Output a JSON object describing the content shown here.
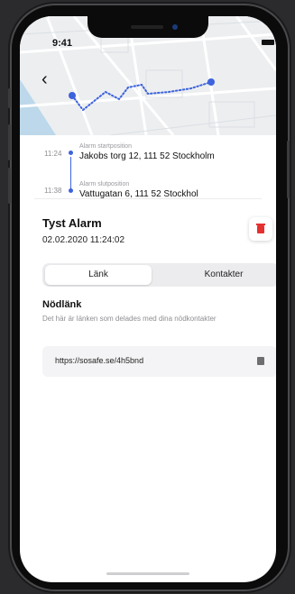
{
  "status": {
    "time": "9:41"
  },
  "map": {
    "back_icon": "chevron-left-icon",
    "route_color": "#3d63dd"
  },
  "route": {
    "start_time": "11:24",
    "start_caption": "Alarm startposition",
    "start_address": "Jakobs torg 12, 111 52 Stockholm",
    "end_time": "11:38",
    "end_caption": "Alarm slutposition",
    "end_address": "Vattugatan 6, 111 52 Stockhol"
  },
  "alarm": {
    "title": "Tyst Alarm",
    "datetime": "02.02.2020  11:24:02",
    "delete_icon": "trash-icon",
    "accent": "#e53030"
  },
  "tabs": [
    {
      "label": "Länk",
      "active": true
    },
    {
      "label": "Kontakter",
      "active": false
    }
  ],
  "emergency": {
    "heading": "Nödlänk",
    "description": "Det här är länken som delades med dina nödkontakter",
    "link": "https://sosafe.se/4h5bnd",
    "copy_icon": "copy-icon"
  }
}
